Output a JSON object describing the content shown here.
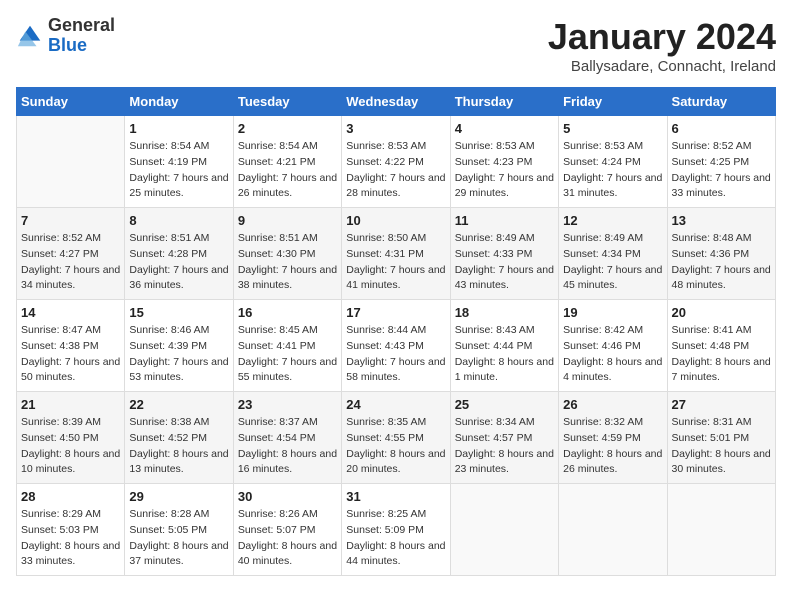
{
  "header": {
    "logo_general": "General",
    "logo_blue": "Blue",
    "month_title": "January 2024",
    "location": "Ballysadare, Connacht, Ireland"
  },
  "weekdays": [
    "Sunday",
    "Monday",
    "Tuesday",
    "Wednesday",
    "Thursday",
    "Friday",
    "Saturday"
  ],
  "weeks": [
    [
      {
        "day": "",
        "sunrise": "",
        "sunset": "",
        "daylight": ""
      },
      {
        "day": "1",
        "sunrise": "Sunrise: 8:54 AM",
        "sunset": "Sunset: 4:19 PM",
        "daylight": "Daylight: 7 hours and 25 minutes."
      },
      {
        "day": "2",
        "sunrise": "Sunrise: 8:54 AM",
        "sunset": "Sunset: 4:21 PM",
        "daylight": "Daylight: 7 hours and 26 minutes."
      },
      {
        "day": "3",
        "sunrise": "Sunrise: 8:53 AM",
        "sunset": "Sunset: 4:22 PM",
        "daylight": "Daylight: 7 hours and 28 minutes."
      },
      {
        "day": "4",
        "sunrise": "Sunrise: 8:53 AM",
        "sunset": "Sunset: 4:23 PM",
        "daylight": "Daylight: 7 hours and 29 minutes."
      },
      {
        "day": "5",
        "sunrise": "Sunrise: 8:53 AM",
        "sunset": "Sunset: 4:24 PM",
        "daylight": "Daylight: 7 hours and 31 minutes."
      },
      {
        "day": "6",
        "sunrise": "Sunrise: 8:52 AM",
        "sunset": "Sunset: 4:25 PM",
        "daylight": "Daylight: 7 hours and 33 minutes."
      }
    ],
    [
      {
        "day": "7",
        "sunrise": "Sunrise: 8:52 AM",
        "sunset": "Sunset: 4:27 PM",
        "daylight": "Daylight: 7 hours and 34 minutes."
      },
      {
        "day": "8",
        "sunrise": "Sunrise: 8:51 AM",
        "sunset": "Sunset: 4:28 PM",
        "daylight": "Daylight: 7 hours and 36 minutes."
      },
      {
        "day": "9",
        "sunrise": "Sunrise: 8:51 AM",
        "sunset": "Sunset: 4:30 PM",
        "daylight": "Daylight: 7 hours and 38 minutes."
      },
      {
        "day": "10",
        "sunrise": "Sunrise: 8:50 AM",
        "sunset": "Sunset: 4:31 PM",
        "daylight": "Daylight: 7 hours and 41 minutes."
      },
      {
        "day": "11",
        "sunrise": "Sunrise: 8:49 AM",
        "sunset": "Sunset: 4:33 PM",
        "daylight": "Daylight: 7 hours and 43 minutes."
      },
      {
        "day": "12",
        "sunrise": "Sunrise: 8:49 AM",
        "sunset": "Sunset: 4:34 PM",
        "daylight": "Daylight: 7 hours and 45 minutes."
      },
      {
        "day": "13",
        "sunrise": "Sunrise: 8:48 AM",
        "sunset": "Sunset: 4:36 PM",
        "daylight": "Daylight: 7 hours and 48 minutes."
      }
    ],
    [
      {
        "day": "14",
        "sunrise": "Sunrise: 8:47 AM",
        "sunset": "Sunset: 4:38 PM",
        "daylight": "Daylight: 7 hours and 50 minutes."
      },
      {
        "day": "15",
        "sunrise": "Sunrise: 8:46 AM",
        "sunset": "Sunset: 4:39 PM",
        "daylight": "Daylight: 7 hours and 53 minutes."
      },
      {
        "day": "16",
        "sunrise": "Sunrise: 8:45 AM",
        "sunset": "Sunset: 4:41 PM",
        "daylight": "Daylight: 7 hours and 55 minutes."
      },
      {
        "day": "17",
        "sunrise": "Sunrise: 8:44 AM",
        "sunset": "Sunset: 4:43 PM",
        "daylight": "Daylight: 7 hours and 58 minutes."
      },
      {
        "day": "18",
        "sunrise": "Sunrise: 8:43 AM",
        "sunset": "Sunset: 4:44 PM",
        "daylight": "Daylight: 8 hours and 1 minute."
      },
      {
        "day": "19",
        "sunrise": "Sunrise: 8:42 AM",
        "sunset": "Sunset: 4:46 PM",
        "daylight": "Daylight: 8 hours and 4 minutes."
      },
      {
        "day": "20",
        "sunrise": "Sunrise: 8:41 AM",
        "sunset": "Sunset: 4:48 PM",
        "daylight": "Daylight: 8 hours and 7 minutes."
      }
    ],
    [
      {
        "day": "21",
        "sunrise": "Sunrise: 8:39 AM",
        "sunset": "Sunset: 4:50 PM",
        "daylight": "Daylight: 8 hours and 10 minutes."
      },
      {
        "day": "22",
        "sunrise": "Sunrise: 8:38 AM",
        "sunset": "Sunset: 4:52 PM",
        "daylight": "Daylight: 8 hours and 13 minutes."
      },
      {
        "day": "23",
        "sunrise": "Sunrise: 8:37 AM",
        "sunset": "Sunset: 4:54 PM",
        "daylight": "Daylight: 8 hours and 16 minutes."
      },
      {
        "day": "24",
        "sunrise": "Sunrise: 8:35 AM",
        "sunset": "Sunset: 4:55 PM",
        "daylight": "Daylight: 8 hours and 20 minutes."
      },
      {
        "day": "25",
        "sunrise": "Sunrise: 8:34 AM",
        "sunset": "Sunset: 4:57 PM",
        "daylight": "Daylight: 8 hours and 23 minutes."
      },
      {
        "day": "26",
        "sunrise": "Sunrise: 8:32 AM",
        "sunset": "Sunset: 4:59 PM",
        "daylight": "Daylight: 8 hours and 26 minutes."
      },
      {
        "day": "27",
        "sunrise": "Sunrise: 8:31 AM",
        "sunset": "Sunset: 5:01 PM",
        "daylight": "Daylight: 8 hours and 30 minutes."
      }
    ],
    [
      {
        "day": "28",
        "sunrise": "Sunrise: 8:29 AM",
        "sunset": "Sunset: 5:03 PM",
        "daylight": "Daylight: 8 hours and 33 minutes."
      },
      {
        "day": "29",
        "sunrise": "Sunrise: 8:28 AM",
        "sunset": "Sunset: 5:05 PM",
        "daylight": "Daylight: 8 hours and 37 minutes."
      },
      {
        "day": "30",
        "sunrise": "Sunrise: 8:26 AM",
        "sunset": "Sunset: 5:07 PM",
        "daylight": "Daylight: 8 hours and 40 minutes."
      },
      {
        "day": "31",
        "sunrise": "Sunrise: 8:25 AM",
        "sunset": "Sunset: 5:09 PM",
        "daylight": "Daylight: 8 hours and 44 minutes."
      },
      {
        "day": "",
        "sunrise": "",
        "sunset": "",
        "daylight": ""
      },
      {
        "day": "",
        "sunrise": "",
        "sunset": "",
        "daylight": ""
      },
      {
        "day": "",
        "sunrise": "",
        "sunset": "",
        "daylight": ""
      }
    ]
  ]
}
